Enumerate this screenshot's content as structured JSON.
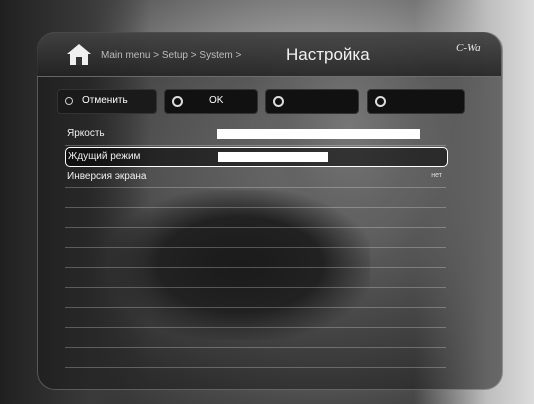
{
  "header": {
    "breadcrumb": "Main menu > Setup > System >",
    "title": "Настройка",
    "logo": "C-Wa"
  },
  "buttons": {
    "cancel_label": "Отменить",
    "ok_label": "OK",
    "empty1_label": "",
    "empty2_label": ""
  },
  "settings": {
    "brightness": {
      "label": "Яркость",
      "level": 1.0
    },
    "standby": {
      "label": "Ждущий режим",
      "level": 0.54
    },
    "invert": {
      "label": "Инверсия экрана",
      "value": "нет"
    }
  }
}
